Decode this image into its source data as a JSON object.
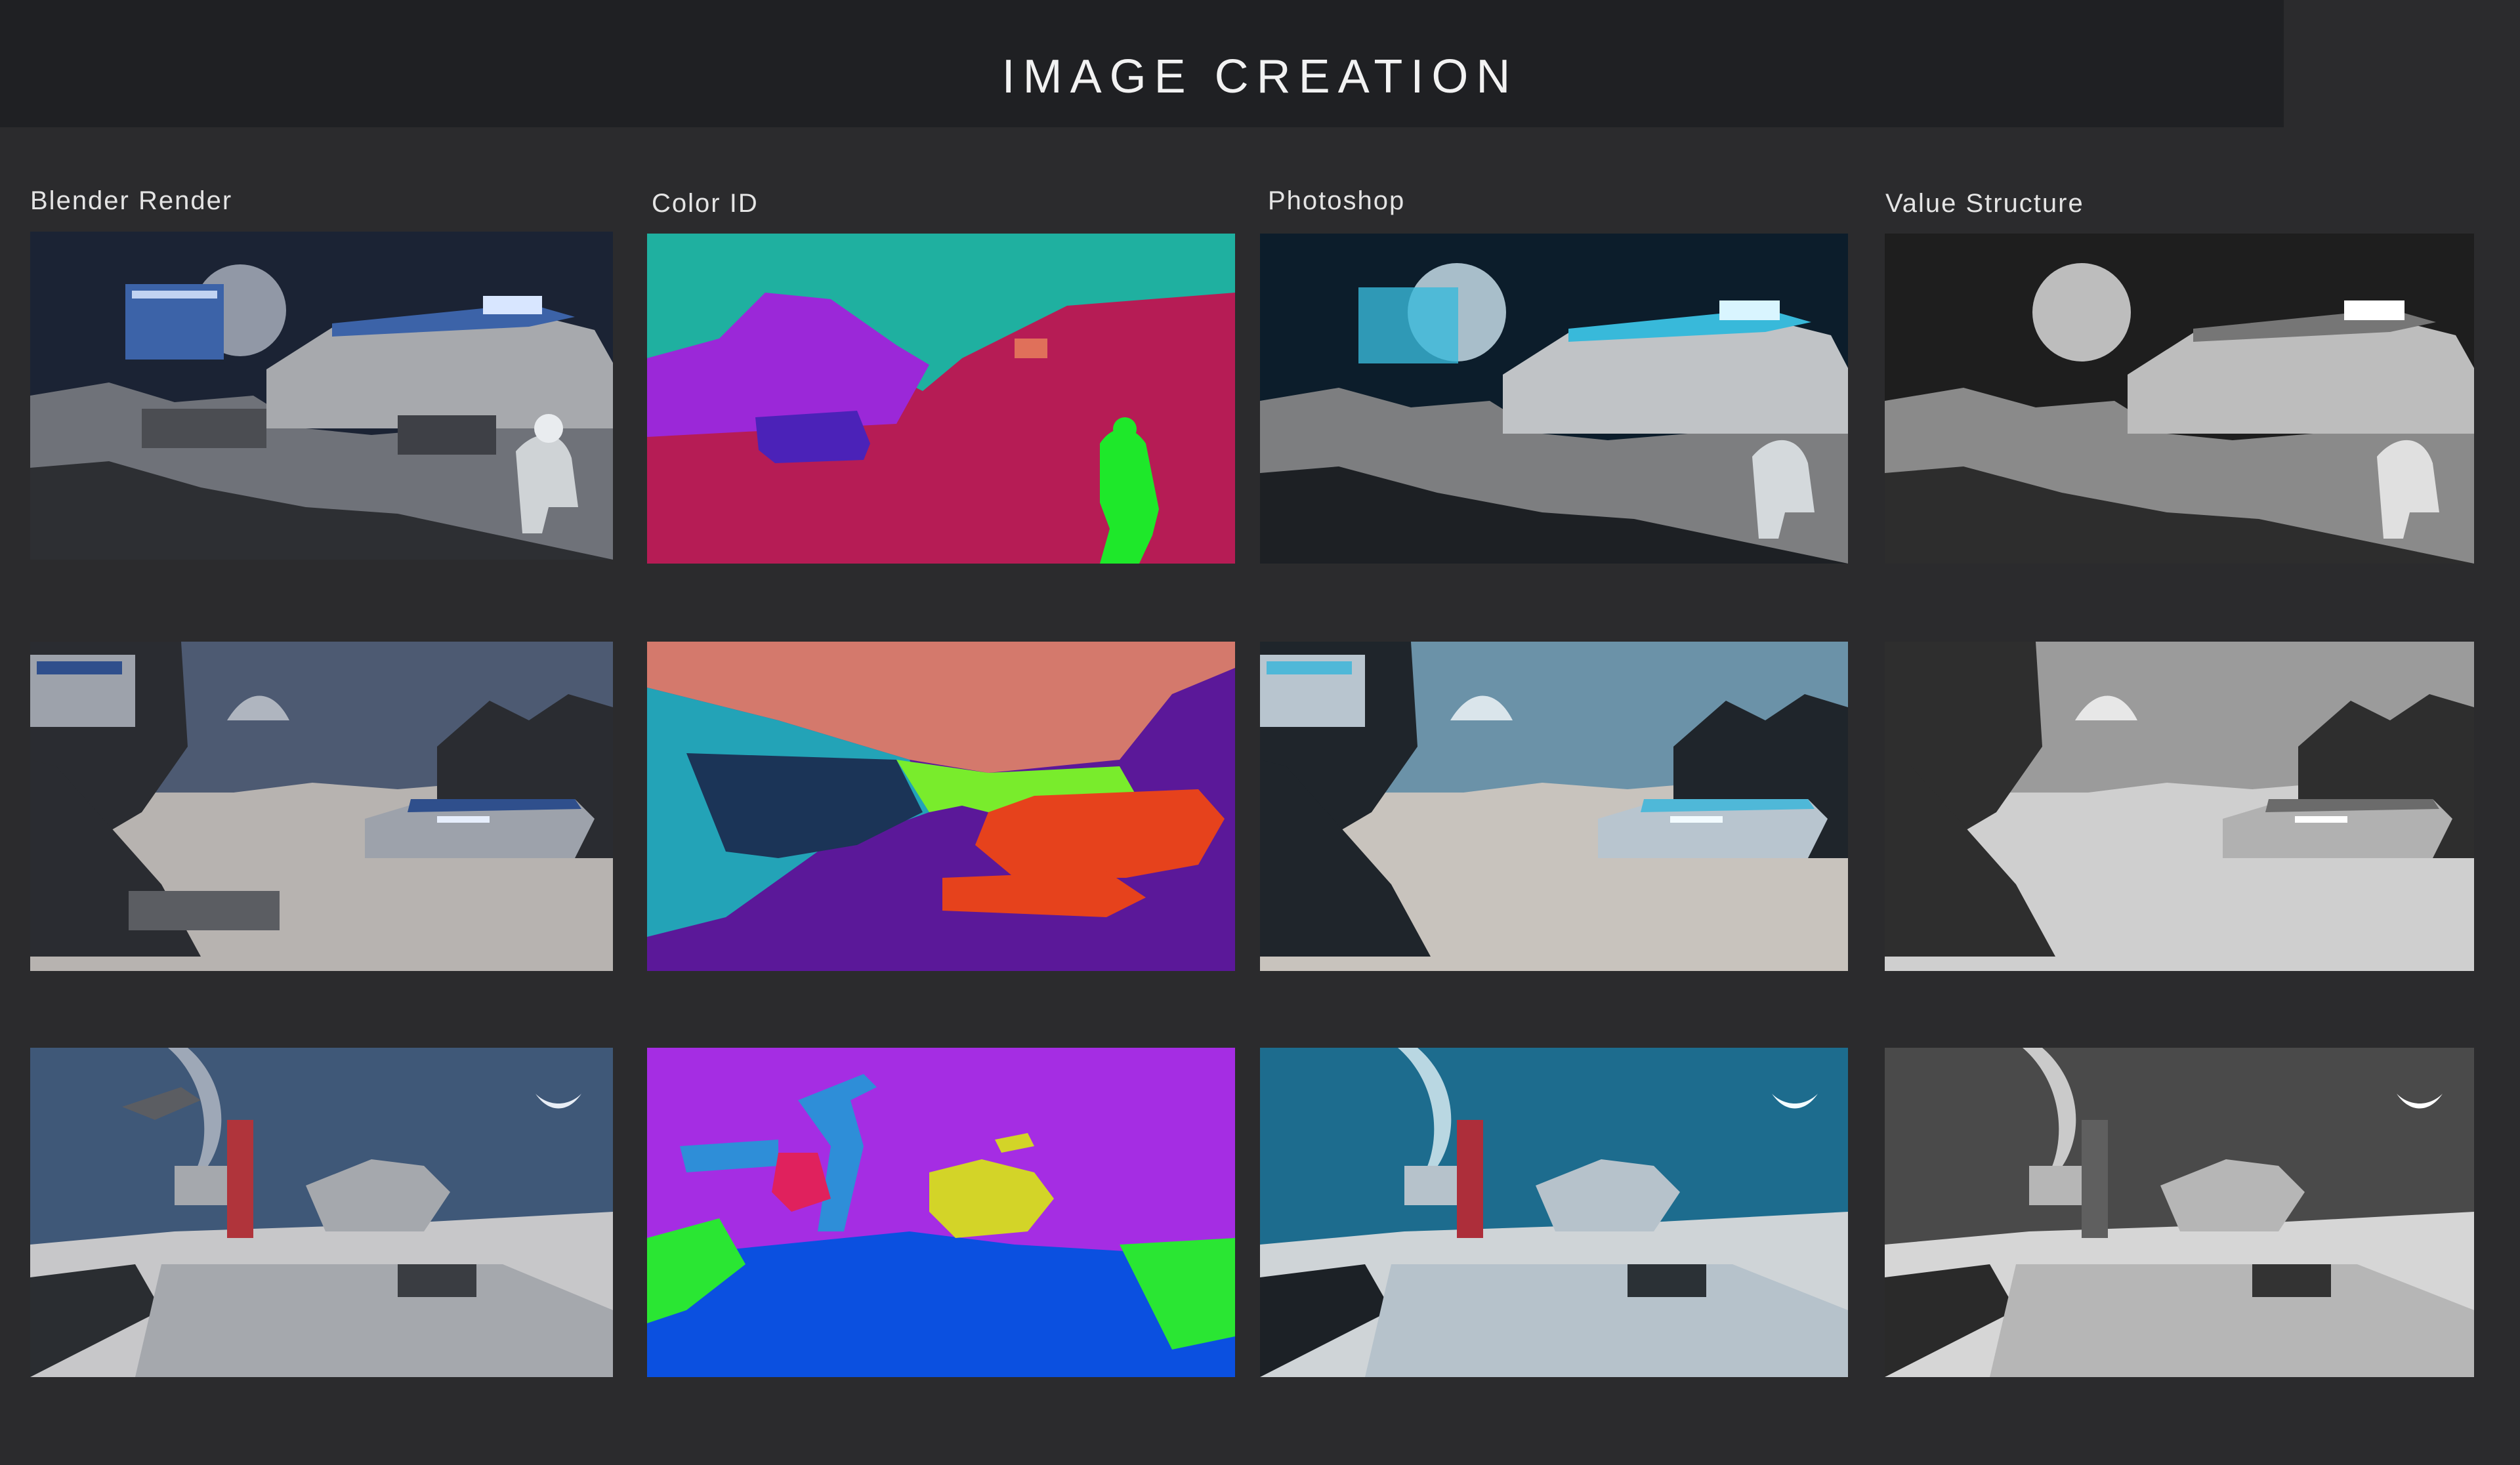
{
  "page": {
    "title": "IMAGE CREATION",
    "columns": [
      "Blender Render",
      "Color ID",
      "Photoshop",
      "Value Structure"
    ]
  },
  "rows": [
    {
      "scene": "moonbase-astronaut",
      "render_palette": {
        "sky": "#1b2334",
        "ground": "#6f7279",
        "rock": "#2d2f33",
        "building": "#a7a9ad",
        "accent": "#3c63a8",
        "glow": "#d8e6ff"
      },
      "colorid_palette": [
        "#1fb0a0",
        "#9b28d8",
        "#b61c55",
        "#4b22b8",
        "#1ee82a"
      ],
      "photoshop_palette": {
        "sky": "#0c1d2b",
        "ground": "#7d7e80",
        "rock": "#1d2024",
        "building": "#c0c3c6",
        "accent": "#38b9da",
        "glow": "#d9f5ff"
      },
      "value_palette": {
        "sky": "#1e1e1e",
        "ground": "#8a8a8a",
        "rock": "#2d2d2d",
        "building": "#bdbdbd",
        "accent": "#767676",
        "glow": "#ffffff"
      }
    },
    {
      "scene": "cliff-base-valley",
      "render_palette": {
        "sky": "#4d5a72",
        "ground": "#b7b3b0",
        "rock": "#2a2c31",
        "building": "#9da2ab",
        "accent": "#2f4f8c",
        "glow": "#e6eefc"
      },
      "colorid_palette": [
        "#d4796c",
        "#23a3b7",
        "#1b3457",
        "#79ec2c",
        "#e6421c",
        "#5b1899"
      ],
      "photoshop_palette": {
        "sky": "#6b92a8",
        "ground": "#c8c3bd",
        "rock": "#1f252b",
        "building": "#b8c5cf",
        "accent": "#4fb8d8",
        "glow": "#f2fbff"
      },
      "value_palette": {
        "sky": "#9b9b9b",
        "ground": "#cfcfcf",
        "rock": "#2e2e2e",
        "building": "#b1b1b1",
        "accent": "#6b6b6b",
        "glow": "#ffffff"
      }
    },
    {
      "scene": "crane-platform",
      "render_palette": {
        "sky": "#3f5878",
        "ground": "#c7c7c9",
        "rock": "#2a2d31",
        "building": "#a5a8ad",
        "accent": "#b0343b",
        "glow": "#eef2ff"
      },
      "colorid_palette": [
        "#a52de3",
        "#2e8ed8",
        "#0b50e0",
        "#2ae633",
        "#d3d428",
        "#e0215d"
      ],
      "photoshop_palette": {
        "sky": "#1d6c8e",
        "ground": "#cfd4d7",
        "rock": "#1c2126",
        "building": "#b6c2cb",
        "accent": "#ad2e3a",
        "glow": "#f2fbff"
      },
      "value_palette": {
        "sky": "#4a4a4a",
        "ground": "#d6d6d6",
        "rock": "#2a2a2a",
        "building": "#b6b6b6",
        "accent": "#5f5f5f",
        "glow": "#ffffff"
      }
    }
  ]
}
